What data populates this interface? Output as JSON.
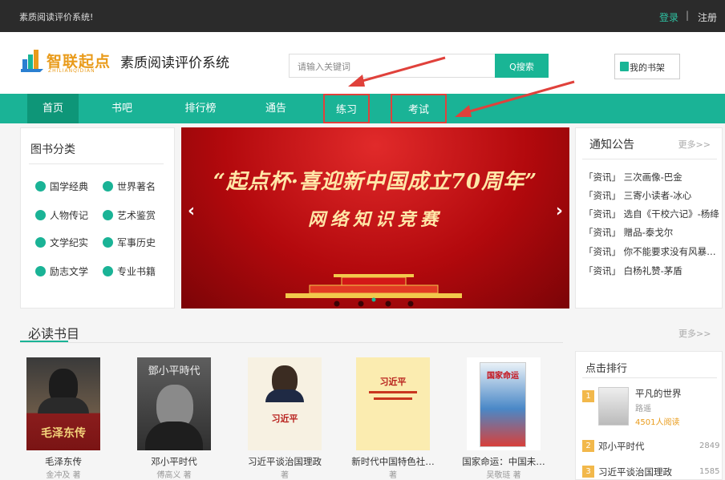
{
  "topbar": {
    "welcome": "素质阅读评价系统!",
    "login": "登录",
    "separator": "|",
    "register": "注册"
  },
  "header": {
    "logo_text": "智联起点",
    "logo_sub": "ZHILIANQIDIAN",
    "site_title": "素质阅读评价系统",
    "search_placeholder": "请输入关键词",
    "search_button": "Q搜索",
    "shelf_button": "我的书架"
  },
  "nav": {
    "items": [
      "首页",
      "书吧",
      "排行榜",
      "通告",
      "练习",
      "考试"
    ]
  },
  "categories": {
    "title": "图书分类",
    "items": [
      "国学经典",
      "世界著名",
      "人物传记",
      "艺术鉴赏",
      "文学纪实",
      "军事历史",
      "励志文学",
      "专业书籍"
    ]
  },
  "banner": {
    "line1": "“起点杯·喜迎新中国成立70周年”",
    "line2": "网络知识竞赛",
    "prev": "‹",
    "next": "›"
  },
  "notices": {
    "title": "通知公告",
    "more": "更多>>",
    "items": [
      "「资讯」 三次画像-巴金",
      "「资讯」 三寄小读者-冰心",
      "「资讯」 选自《干校六记》-杨绛",
      "「资讯」 赠品-泰戈尔",
      "「资讯」 你不能要求没有风暴的…",
      "「资讯」 白杨礼赞-茅盾"
    ]
  },
  "must_read": {
    "title": "必读书目",
    "more": "更多>>",
    "books": [
      {
        "title": "毛泽东传",
        "author": "金冲及 著",
        "cover_text": "毛泽东传"
      },
      {
        "title": "邓小平时代",
        "author": "傅高义 著",
        "cover_text": "鄧小平時代"
      },
      {
        "title": "习近平谈治国理政",
        "author": "著",
        "cover_text": "习近平"
      },
      {
        "title": "新时代中国特色社…",
        "author": "著",
        "cover_text": "习近平"
      },
      {
        "title": "国家命运：中国未…",
        "author": "吴敬琏 著",
        "cover_text": "国家命运"
      }
    ]
  },
  "ranking": {
    "title": "点击排行",
    "top": {
      "rank": "1",
      "title": "平凡的世界",
      "author": "路遥",
      "reads": "4501人阅读"
    },
    "items": [
      {
        "rank": "2",
        "title": "邓小平时代",
        "count": "2849"
      },
      {
        "rank": "3",
        "title": "习近平谈治国理政",
        "count": "1585"
      }
    ]
  },
  "colors": {
    "accent": "#1ab396",
    "topbar": "#2b2b2b",
    "annotation": "#e0413b"
  }
}
